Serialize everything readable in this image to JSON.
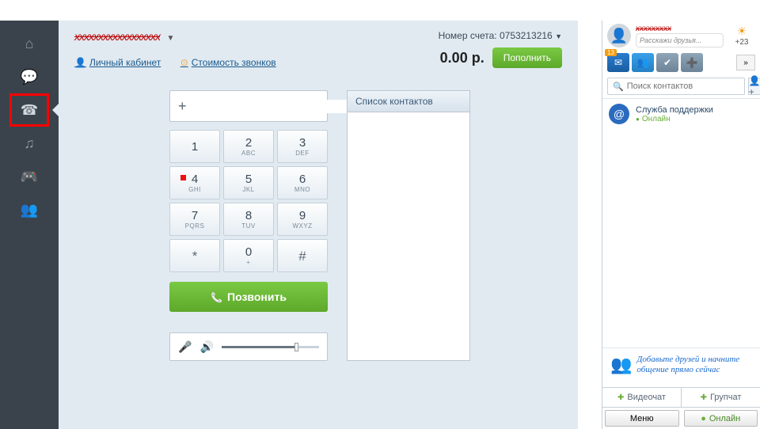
{
  "sidebar": {
    "tabs": [
      {
        "name": "home",
        "icon": "⌂"
      },
      {
        "name": "chat",
        "icon": "💬"
      },
      {
        "name": "phone",
        "icon": "☎",
        "active": true
      },
      {
        "name": "music",
        "icon": "♫"
      },
      {
        "name": "games",
        "icon": "🎮"
      },
      {
        "name": "people",
        "icon": "👥"
      }
    ]
  },
  "header": {
    "username_redacted": "xxxxxxxxxxxxxxxxxx",
    "links": {
      "account": "Личный кабинет",
      "rates": "Стоимость звонков"
    },
    "account_label": "Номер счета:",
    "account_number": "0753213216",
    "balance": "0.00 р.",
    "topup_label": "Пополнить"
  },
  "dialer": {
    "input_value": "",
    "plus_label": "+",
    "keys": [
      {
        "num": "1",
        "sub": ""
      },
      {
        "num": "2",
        "sub": "ABC"
      },
      {
        "num": "3",
        "sub": "DEF"
      },
      {
        "num": "4",
        "sub": "GHI"
      },
      {
        "num": "5",
        "sub": "JKL"
      },
      {
        "num": "6",
        "sub": "MNO"
      },
      {
        "num": "7",
        "sub": "PQRS"
      },
      {
        "num": "8",
        "sub": "TUV"
      },
      {
        "num": "9",
        "sub": "WXYZ"
      },
      {
        "num": "*",
        "sub": ""
      },
      {
        "num": "0",
        "sub": "+"
      },
      {
        "num": "#",
        "sub": ""
      }
    ],
    "call_label": "Позвонить"
  },
  "contacts_panel": {
    "title": "Список контактов"
  },
  "right": {
    "status_placeholder": "Расскажи друзья...",
    "weather_temp": "+23",
    "mail_badge": "13",
    "search_placeholder": "Поиск контактов",
    "contacts": [
      {
        "name": "Служба поддержки",
        "status": "Онлайн"
      }
    ],
    "promo_text": "Добавьте друзей и начните общение прямо сейчас",
    "videochat_label": "Видеочат",
    "groupchat_label": "Групчат",
    "menu_label": "Меню",
    "online_label": "Онлайн"
  }
}
